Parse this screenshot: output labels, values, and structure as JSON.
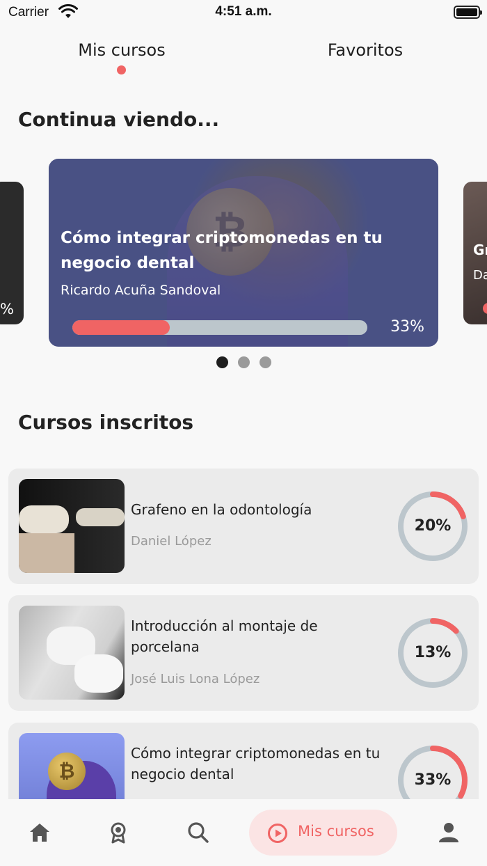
{
  "status_bar": {
    "carrier": "Carrier",
    "time": "4:51 a.m."
  },
  "tabs": [
    {
      "label": "Mis cursos",
      "selected": true
    },
    {
      "label": "Favoritos",
      "selected": false
    }
  ],
  "continue_section": {
    "heading": "Continua viendo...",
    "left_peek": {
      "progress_text": "%"
    },
    "right_peek": {
      "title_fragment": "Gr",
      "author_fragment": "Da"
    },
    "featured": {
      "title": "Cómo integrar criptomonedas en tu negocio dental",
      "author": "Ricardo Acuña Sandoval",
      "progress": 0.33,
      "progress_text": "33%"
    },
    "carousel_pages": 3,
    "carousel_active_index": 0
  },
  "enrolled_section": {
    "heading": "Cursos inscritos",
    "courses": [
      {
        "title": "Grafeno en la odontología",
        "author": "Daniel López",
        "progress": 0.2,
        "progress_text": "20%"
      },
      {
        "title": "Introducción al montaje de porcelana",
        "author": "José Luis Lona López",
        "progress": 0.13,
        "progress_text": "13%"
      },
      {
        "title": "Cómo integrar criptomonedas en tu negocio dental",
        "author": "",
        "progress": 0.33,
        "progress_text": "33%"
      }
    ]
  },
  "bottom_nav": {
    "items": [
      {
        "icon": "home-icon"
      },
      {
        "icon": "award-icon"
      },
      {
        "icon": "search-icon"
      },
      {
        "icon": "play-circle-icon",
        "label": "Mis cursos",
        "active": true
      },
      {
        "icon": "profile-icon"
      }
    ]
  },
  "colors": {
    "accent": "#f06464",
    "track": "#bcc6cc",
    "card_bg": "#ebebeb",
    "background": "#f8f8f8",
    "nav_active_bg": "#fbe4e4"
  }
}
